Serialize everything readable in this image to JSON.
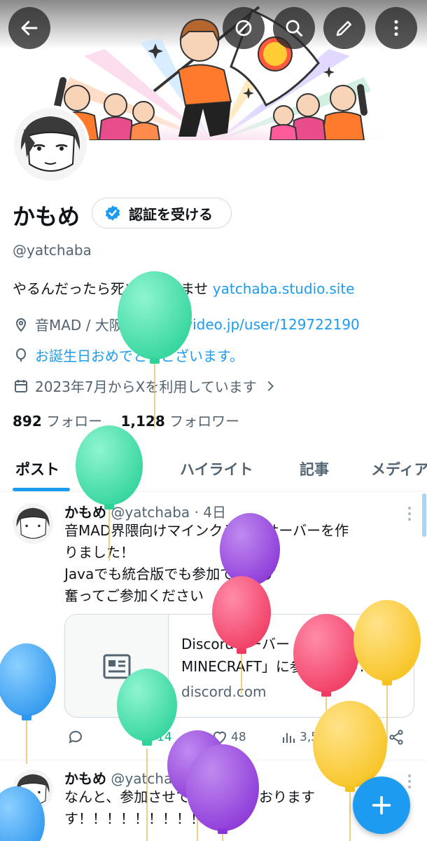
{
  "profile": {
    "name": "かもめ",
    "verify_label": "認証を受ける",
    "handle": "@yatchaba",
    "bio_text": "やるんだったら死ぬ気でかませ ",
    "bio_link": "yatchaba.studio.site",
    "location": "音MAD / 大阪",
    "website": "nicovideo.jp/user/129722190",
    "birthday": "お誕生日おめでとうございます。",
    "joined": "2023年7月からXを利用しています",
    "following_count": "892",
    "following_label": "フォロー",
    "followers_count": "1,128",
    "followers_label": "フォロワー"
  },
  "tabs": [
    "ポスト",
    "返信",
    "ハイライト",
    "記事",
    "メディア"
  ],
  "posts": [
    {
      "name": "かもめ",
      "handle": "@yatchaba",
      "time": "· 4日",
      "lines": [
        "音MAD界隈向けマインクラフトサーバーを作",
        "りました！",
        "Javaでも統合版でも参加できます",
        "奮ってご参加ください"
      ],
      "card": {
        "title_line1": "Discordサーバー「音",
        "title_line2": "MINECRAFT」に参加しよう...",
        "domain": "discord.com"
      },
      "stats": {
        "reposts": "14",
        "likes": "48",
        "views": "3,522"
      }
    },
    {
      "name": "かもめ",
      "handle": "@yatchaba",
      "time": "· 44分",
      "lines": [
        "なんと、参加させていただいております",
        "す！！！！！！！！！"
      ]
    }
  ],
  "colors": {
    "accent": "#1d9bf0",
    "text": "#0f1419",
    "muted": "#536471",
    "repost": "#00ba7c"
  },
  "icons": [
    "back-arrow-icon",
    "no-entry-icon",
    "search-icon",
    "edit-icon",
    "more-vertical-icon",
    "verified-badge-icon",
    "location-icon",
    "link-icon",
    "balloon-icon",
    "calendar-icon",
    "chevron-right-icon",
    "reply-icon",
    "repost-icon",
    "like-icon",
    "views-icon",
    "bookmark-icon",
    "share-icon",
    "plus-icon"
  ]
}
